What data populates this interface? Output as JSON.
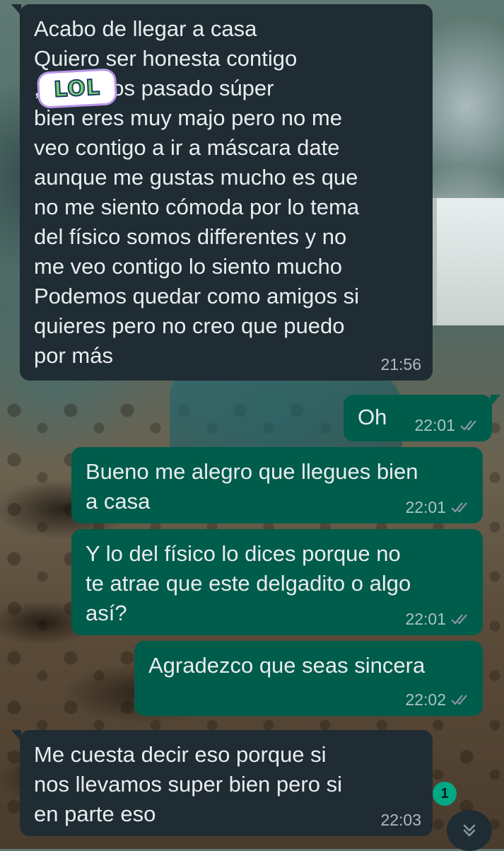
{
  "chat": {
    "messages": [
      {
        "direction": "incoming",
        "text": "Acabo de llegar a casa\nQuiero ser honesta contigo\n              , lo hemos pasado súper\nbien eres muy majo pero no me\nveo contigo a ir a máscara date\naunque me gustas mucho es que\nno me siento cómoda por lo tema\ndel físico somos differentes y no\nme veo contigo lo siento mucho\nPodemos quedar como amigos si\nquieres pero no creo que puedo\npor más",
        "time": "21:56"
      },
      {
        "direction": "outgoing",
        "text": "Oh",
        "time": "22:01",
        "status": "read"
      },
      {
        "direction": "outgoing",
        "text": "Bueno me alegro que llegues bien\na casa",
        "time": "22:01",
        "status": "read"
      },
      {
        "direction": "outgoing",
        "text": "Y lo del físico lo dices porque no\nte atrae que este delgadito o algo\nasí?",
        "time": "22:01",
        "status": "read"
      },
      {
        "direction": "outgoing",
        "text": "Agradezco que seas sincera",
        "time": "22:02",
        "status": "read"
      },
      {
        "direction": "incoming",
        "text": "Me cuesta decir eso porque si\nnos llevamos super bien pero si\nen parte eso",
        "time": "22:03"
      }
    ],
    "sticker": {
      "label": "LOL"
    },
    "unread_badge": "1",
    "scroll_icon": "chevron-double-down-icon"
  },
  "colors": {
    "incoming_bubble": "#1f2c34",
    "outgoing_bubble": "#005c4b",
    "read_ticks": "#8696a0",
    "badge": "#00a884"
  }
}
